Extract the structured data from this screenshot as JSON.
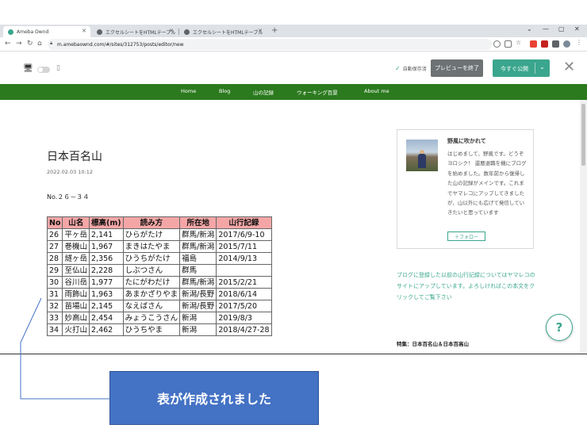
{
  "browser": {
    "tabs": [
      {
        "title": "Ameba Ownd"
      },
      {
        "title": "エクセルシートをHTMLテーブルに変換"
      },
      {
        "title": "エクセルシートをHTMLテーブルに変換"
      }
    ],
    "url": "m.amebaownd.com/#/sites/312753/posts/editor/new"
  },
  "editor": {
    "autosave_label": "自動保存済",
    "preview_end_label": "プレビューを終了",
    "publish_label": "今すぐ公開"
  },
  "site_nav": {
    "items": [
      "Home",
      "Blog",
      "山の記録",
      "ウォーキング百景",
      "About me"
    ]
  },
  "post": {
    "title": "日本百名山",
    "date": "2022.02.03 10:12",
    "body": "No.２６－３４"
  },
  "table": {
    "headers": [
      "No",
      "山名",
      "標高(m)",
      "読み方",
      "所在地",
      "山行記録"
    ],
    "rows": [
      [
        "26",
        "平ヶ岳",
        "2,141",
        "ひらがたけ",
        "群馬/新潟",
        "2017/6/9-10"
      ],
      [
        "27",
        "巻機山",
        "1,967",
        "まきはたやま",
        "群馬/新潟",
        "2015/7/11"
      ],
      [
        "28",
        "燧ヶ岳",
        "2,356",
        "ひうちがたけ",
        "福島",
        "2014/9/13"
      ],
      [
        "29",
        "至仏山",
        "2,228",
        "しぶつさん",
        "群馬",
        ""
      ],
      [
        "30",
        "谷川岳",
        "1,977",
        "たにがわだけ",
        "群馬/新潟",
        "2015/2/21"
      ],
      [
        "31",
        "雨飾山",
        "1,963",
        "あまかざりやま",
        "新潟/長野",
        "2018/6/14"
      ],
      [
        "32",
        "苗場山",
        "2,145",
        "なえばさん",
        "新潟/長野",
        "2017/5/20"
      ],
      [
        "33",
        "妙高山",
        "2,454",
        "みょうこうさん",
        "新潟",
        "2019/8/3"
      ],
      [
        "34",
        "火打山",
        "2,462",
        "ひうちやま",
        "新潟",
        "2018/4/27-28"
      ]
    ]
  },
  "sidebar": {
    "profile_name": "野風に吹かれて",
    "profile_desc": "はじめまして、野風です。どうぞヨロシク！ 還暦退職を機にブログを始めました。数年前から復帰した山の記録がメインです。これまでヤマレコにアップしてきましたが、山以外にも広げて発信していきたいと思っています",
    "follow_label": "＋フォロー",
    "link_text": "ブログに登録した以前の山行記録についてはヤマレコのサイトにアップしています。よろしければこの本文をクリックしてご覧下さい",
    "special_label": "特集：日本百名山＆日本百高山"
  },
  "help_label": "?",
  "callout_text": "表が作成されました",
  "colors": {
    "accent": "#3aa68d",
    "site_nav": "#2b7a1e",
    "table_header": "#f4a6a6",
    "callout": "#4472c4"
  }
}
